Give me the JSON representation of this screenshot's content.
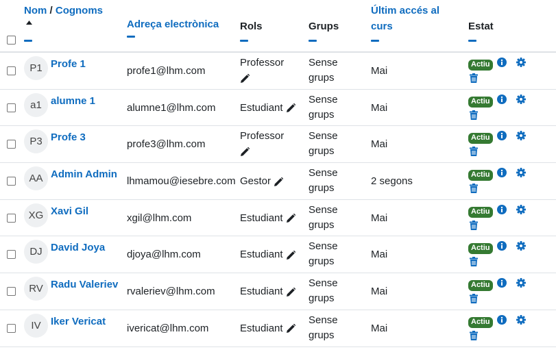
{
  "header": {
    "name_label": "Nom",
    "separator": "/",
    "surname_label": "Cognoms",
    "email_label": "Adreça electrònica",
    "roles_label": "Rols",
    "groups_label": "Grups",
    "last_access_label": "Últim accés al curs",
    "status_label": "Estat"
  },
  "colors": {
    "link": "#0f6cbf",
    "active_badge": "#357a32"
  },
  "rows": [
    {
      "initials": "P1",
      "name": "Profe 1",
      "email": "profe1@lhm.com",
      "role": "Professor",
      "groups": "Sense grups",
      "last_access": "Mai",
      "status": "Actiu"
    },
    {
      "initials": "a1",
      "name": "alumne 1",
      "email": "alumne1@lhm.com",
      "role": "Estudiant",
      "groups": "Sense grups",
      "last_access": "Mai",
      "status": "Actiu"
    },
    {
      "initials": "P3",
      "name": "Profe 3",
      "email": "profe3@lhm.com",
      "role": "Professor",
      "groups": "Sense grups",
      "last_access": "Mai",
      "status": "Actiu"
    },
    {
      "initials": "AA",
      "name": "Admin Admin",
      "email": "lhmamou@iesebre.com",
      "role": "Gestor",
      "groups": "Sense grups",
      "last_access": "2 segons",
      "status": "Actiu"
    },
    {
      "initials": "XG",
      "name": "Xavi Gil",
      "email": "xgil@lhm.com",
      "role": "Estudiant",
      "groups": "Sense grups",
      "last_access": "Mai",
      "status": "Actiu"
    },
    {
      "initials": "DJ",
      "name": "David Joya",
      "email": "djoya@lhm.com",
      "role": "Estudiant",
      "groups": "Sense grups",
      "last_access": "Mai",
      "status": "Actiu"
    },
    {
      "initials": "RV",
      "name": "Radu Valeriev",
      "email": "rvaleriev@lhm.com",
      "role": "Estudiant",
      "groups": "Sense grups",
      "last_access": "Mai",
      "status": "Actiu"
    },
    {
      "initials": "IV",
      "name": "Iker Vericat",
      "email": "ivericat@lhm.com",
      "role": "Estudiant",
      "groups": "Sense grups",
      "last_access": "Mai",
      "status": "Actiu"
    }
  ],
  "icons": {
    "sort": "sort-asc-icon",
    "edit": "pencil-icon",
    "info": "info-icon",
    "settings": "gear-icon",
    "delete": "trash-icon"
  }
}
